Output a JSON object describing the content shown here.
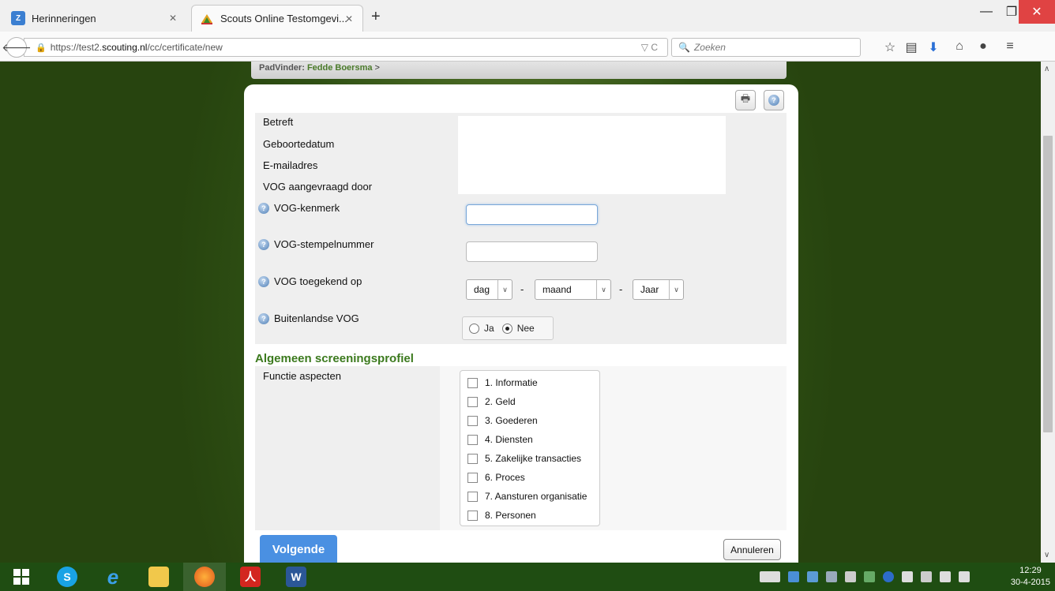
{
  "browser": {
    "tabs": [
      {
        "title": "Herinneringen",
        "active": false
      },
      {
        "title": "Scouts Online Testomgevi...",
        "active": true
      }
    ],
    "new_tab_label": "+",
    "window_controls": {
      "minimize": "—",
      "maximize": "❐",
      "close": "✕"
    },
    "url": {
      "prefix": "https://test2.",
      "domain": "scouting.nl",
      "path": "/cc/certificate/new"
    },
    "search_placeholder": "Zoeken"
  },
  "breadcrumb": {
    "label": "PadVinder:",
    "name": "Fedde Boersma",
    "separator": ">"
  },
  "form": {
    "info_labels": [
      "Betreft",
      "Geboortedatum",
      "E-mailadres",
      "VOG aangevraagd door"
    ],
    "kenmerk_label": "VOG-kenmerk",
    "stempel_label": "VOG-stempelnummer",
    "toegekend_label": "VOG toegekend op",
    "date_day": "dag",
    "date_month": "maand",
    "date_year": "Jaar",
    "date_sep": "-",
    "buitenlandse_label": "Buitenlandse VOG",
    "radio_yes": "Ja",
    "radio_no": "Nee",
    "radio_selected": "Nee"
  },
  "profile": {
    "title": "Algemeen screeningsprofiel",
    "functie_label": "Functie aspecten",
    "aspects": [
      "1. Informatie",
      "2. Geld",
      "3. Goederen",
      "4. Diensten",
      "5. Zakelijke transacties",
      "6. Proces",
      "7. Aansturen organisatie",
      "8. Personen"
    ]
  },
  "buttons": {
    "next": "Volgende",
    "cancel": "Annuleren"
  },
  "taskbar": {
    "time": "12:29",
    "date": "30-4-2015"
  },
  "colors": {
    "accent_blue": "#4a90e2",
    "section_green": "#3c7a1e",
    "close_red": "#e04343",
    "taskbar": "#1f4d12"
  }
}
